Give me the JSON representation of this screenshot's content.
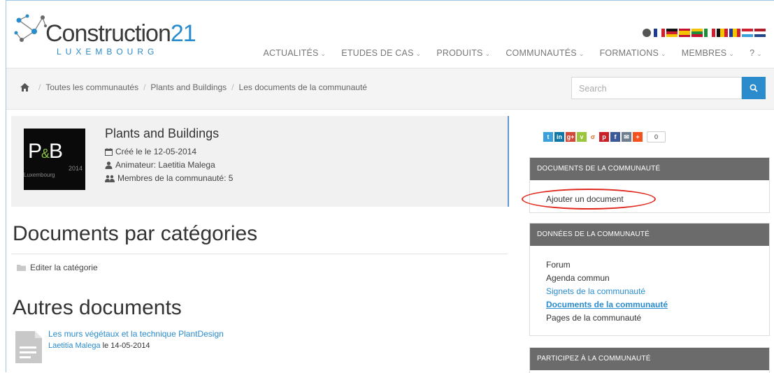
{
  "logo": {
    "title_main": "Construction",
    "title_num": "21",
    "subtitle": "LUXEMBOURG"
  },
  "nav": [
    {
      "label": "ACTUALITÉS"
    },
    {
      "label": "ETUDES DE CAS"
    },
    {
      "label": "PRODUITS"
    },
    {
      "label": "COMMUNAUTÉS"
    },
    {
      "label": "FORMATIONS"
    },
    {
      "label": "MEMBRES"
    },
    {
      "label": "?"
    }
  ],
  "breadcrumb": {
    "items": [
      "Toutes les communautés",
      "Plants and Buildings",
      "Les documents de la communauté"
    ]
  },
  "search": {
    "placeholder": "Search"
  },
  "community": {
    "logo_text": "P",
    "logo_amp": "&",
    "logo_b": "B",
    "logo_year": "2014",
    "logo_place": "Luxembourg",
    "title": "Plants and Buildings",
    "created": "Créé le le 12-05-2014",
    "animator": "Animateur: Laetitia Malega",
    "members": "Membres de la communauté: 5"
  },
  "main": {
    "heading_categories": "Documents par catégories",
    "edit_category": "Editer la catégorie",
    "heading_other": "Autres documents",
    "document": {
      "title": "Les murs végétaux et la technique PlantDesign",
      "author": "Laetitia Malega",
      "date_text": " le 14-05-2014"
    }
  },
  "social": {
    "share_count": "0"
  },
  "sidebar": {
    "docs_panel": {
      "title": "DOCUMENTS DE LA COMMUNAUTÉ",
      "add_document": "Ajouter un document"
    },
    "data_panel": {
      "title": "DONNÉES DE LA COMMUNAUTÉ",
      "items": [
        "Forum",
        "Agenda commun",
        "Signets de la communauté",
        "Documents de la communauté",
        "Pages de la communauté"
      ]
    },
    "participate_panel": {
      "title": "PARTICIPEZ À LA COMMUNAUTÉ"
    }
  },
  "colors": {
    "accent": "#2b8ccd",
    "panel_header": "#6b6b6b",
    "highlight_oval": "#e0281e"
  }
}
